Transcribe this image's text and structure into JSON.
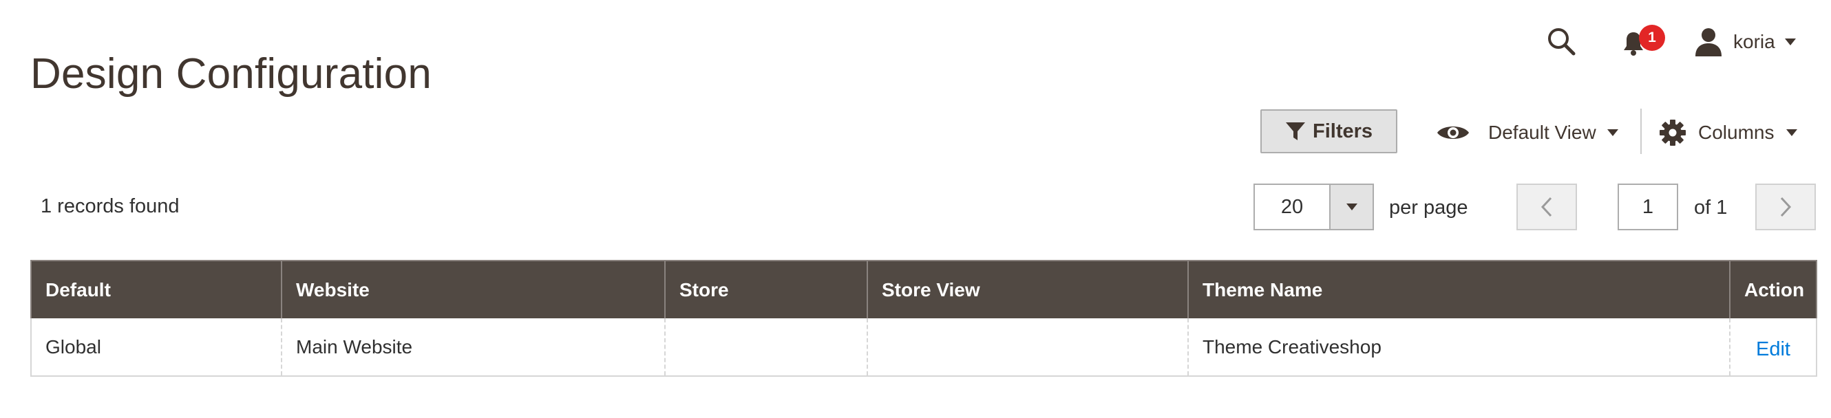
{
  "page": {
    "title": "Design Configuration"
  },
  "header": {
    "notifications_count": "1",
    "user_name": "koria",
    "icons": {
      "search": "search-icon",
      "notifications": "bell-icon",
      "user": "user-icon"
    }
  },
  "toolbar": {
    "filters_label": "Filters",
    "view_label": "Default View",
    "columns_label": "Columns"
  },
  "pagination": {
    "records_found": "1 records found",
    "per_page_value": "20",
    "per_page_label": "per page",
    "current_page": "1",
    "total_pages_label": "of 1"
  },
  "grid": {
    "columns": [
      "Default",
      "Website",
      "Store",
      "Store View",
      "Theme Name",
      "Action"
    ],
    "rows": [
      {
        "default": "Global",
        "website": "Main Website",
        "store": "",
        "store_view": "",
        "theme_name": "Theme Creativeshop",
        "action": "Edit"
      }
    ]
  },
  "colors": {
    "header_bg": "#514943",
    "link": "#007bdb",
    "badge": "#e22626",
    "title": "#41362f"
  }
}
